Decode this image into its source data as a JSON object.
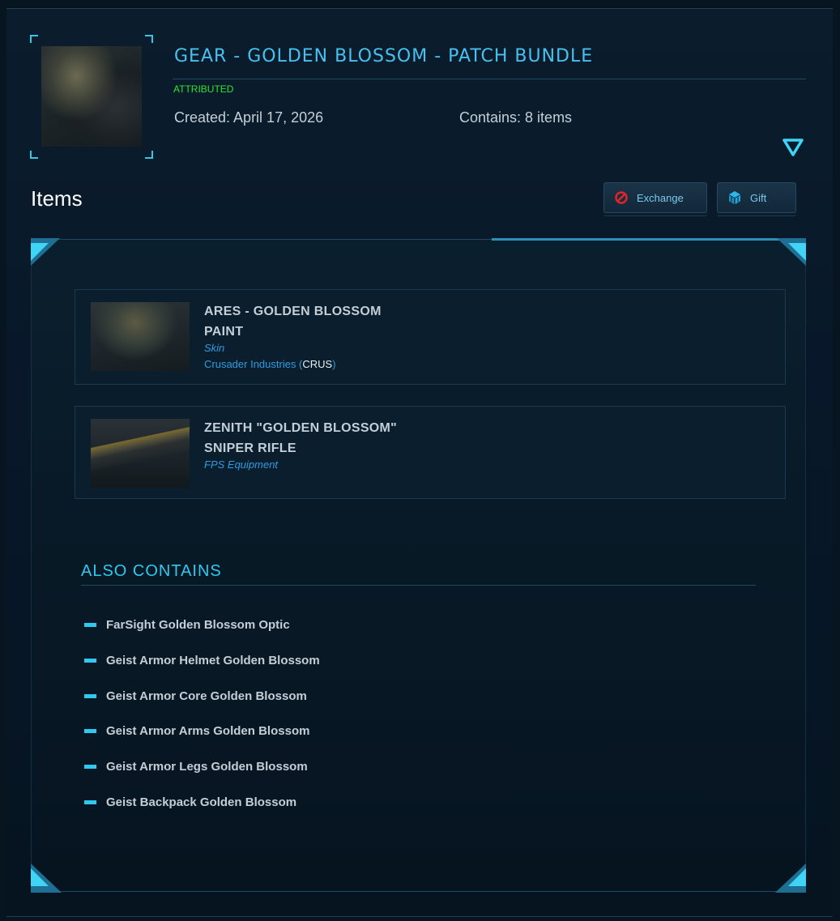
{
  "header": {
    "title": "GEAR - GOLDEN BLOSSOM - PATCH BUNDLE",
    "status": "ATTRIBUTED",
    "created": "Created: April 17, 2026",
    "contains": "Contains: 8 items"
  },
  "items_section": {
    "heading": "Items",
    "actions": {
      "exchange_label": "Exchange",
      "gift_label": "Gift"
    }
  },
  "items": [
    {
      "title_line1": "ARES - GOLDEN BLOSSOM",
      "title_line2": "PAINT",
      "type": "Skin",
      "manufacturer_name": "Crusader Industries (",
      "manufacturer_code": "CRUS",
      "manufacturer_close": ")"
    },
    {
      "title_line1": "ZENITH \"GOLDEN BLOSSOM\"",
      "title_line2": "SNIPER RIFLE",
      "type": "FPS Equipment"
    }
  ],
  "also_contains": {
    "heading": "ALSO CONTAINS",
    "items": [
      "FarSight Golden Blossom Optic",
      "Geist Armor Helmet Golden Blossom",
      "Geist Armor Core Golden Blossom",
      "Geist Armor Arms Golden Blossom",
      "Geist Armor Legs Golden Blossom",
      "Geist Backpack Golden Blossom"
    ]
  },
  "colors": {
    "accent": "#46c1f0",
    "status": "#2fe22f",
    "item_type": "#2f9be0"
  },
  "icons": {
    "exchange": "prohibited-icon",
    "gift": "gift-cube-icon",
    "expand": "triangle-down-icon"
  }
}
